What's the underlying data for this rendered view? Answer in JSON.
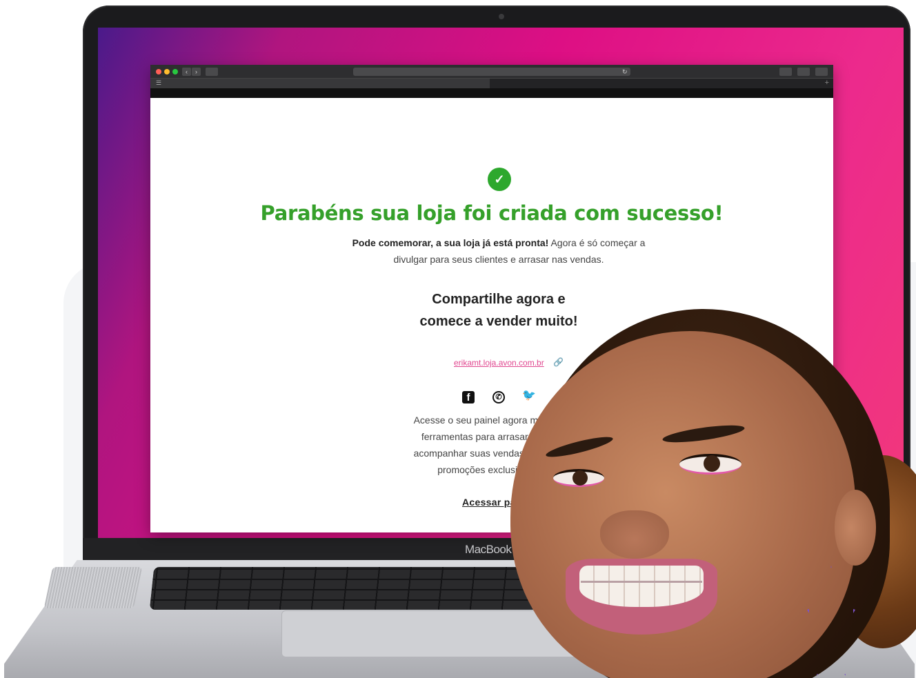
{
  "laptop": {
    "brand": "MacBook"
  },
  "browser": {
    "menu_glyph": "☰",
    "back_glyph": "‹",
    "forward_glyph": "›",
    "reload_glyph": "↻"
  },
  "page": {
    "headline": "Parabéns sua loja foi criada com sucesso!",
    "intro_bold": "Pode comemorar, a sua loja já está pronta!",
    "intro_rest": " Agora é só começar a divulgar para seus clientes e arrasar nas vendas.",
    "share_line1": "Compartilhe agora e",
    "share_line2": "comece a vender muito!",
    "store_url": "erikamt.loja.avon.com.br",
    "panel_line1": "Acesse o seu painel agora mesmo e com",
    "panel_line2": "ferramentas para arrasar nas vendas.",
    "panel_line3": "acompanhar suas vendas, divulgar oferta",
    "panel_line4": "promoções exclusivas e muito",
    "access_label": "Acessar pain"
  },
  "icons": {
    "check": "check-icon",
    "link": "link-icon",
    "facebook": "facebook-icon",
    "whatsapp": "whatsapp-icon",
    "twitter": "twitter-icon"
  },
  "colors": {
    "success_green": "#35a02a",
    "link_pink": "#e0468f",
    "screen_magenta": "#dd0f84"
  }
}
